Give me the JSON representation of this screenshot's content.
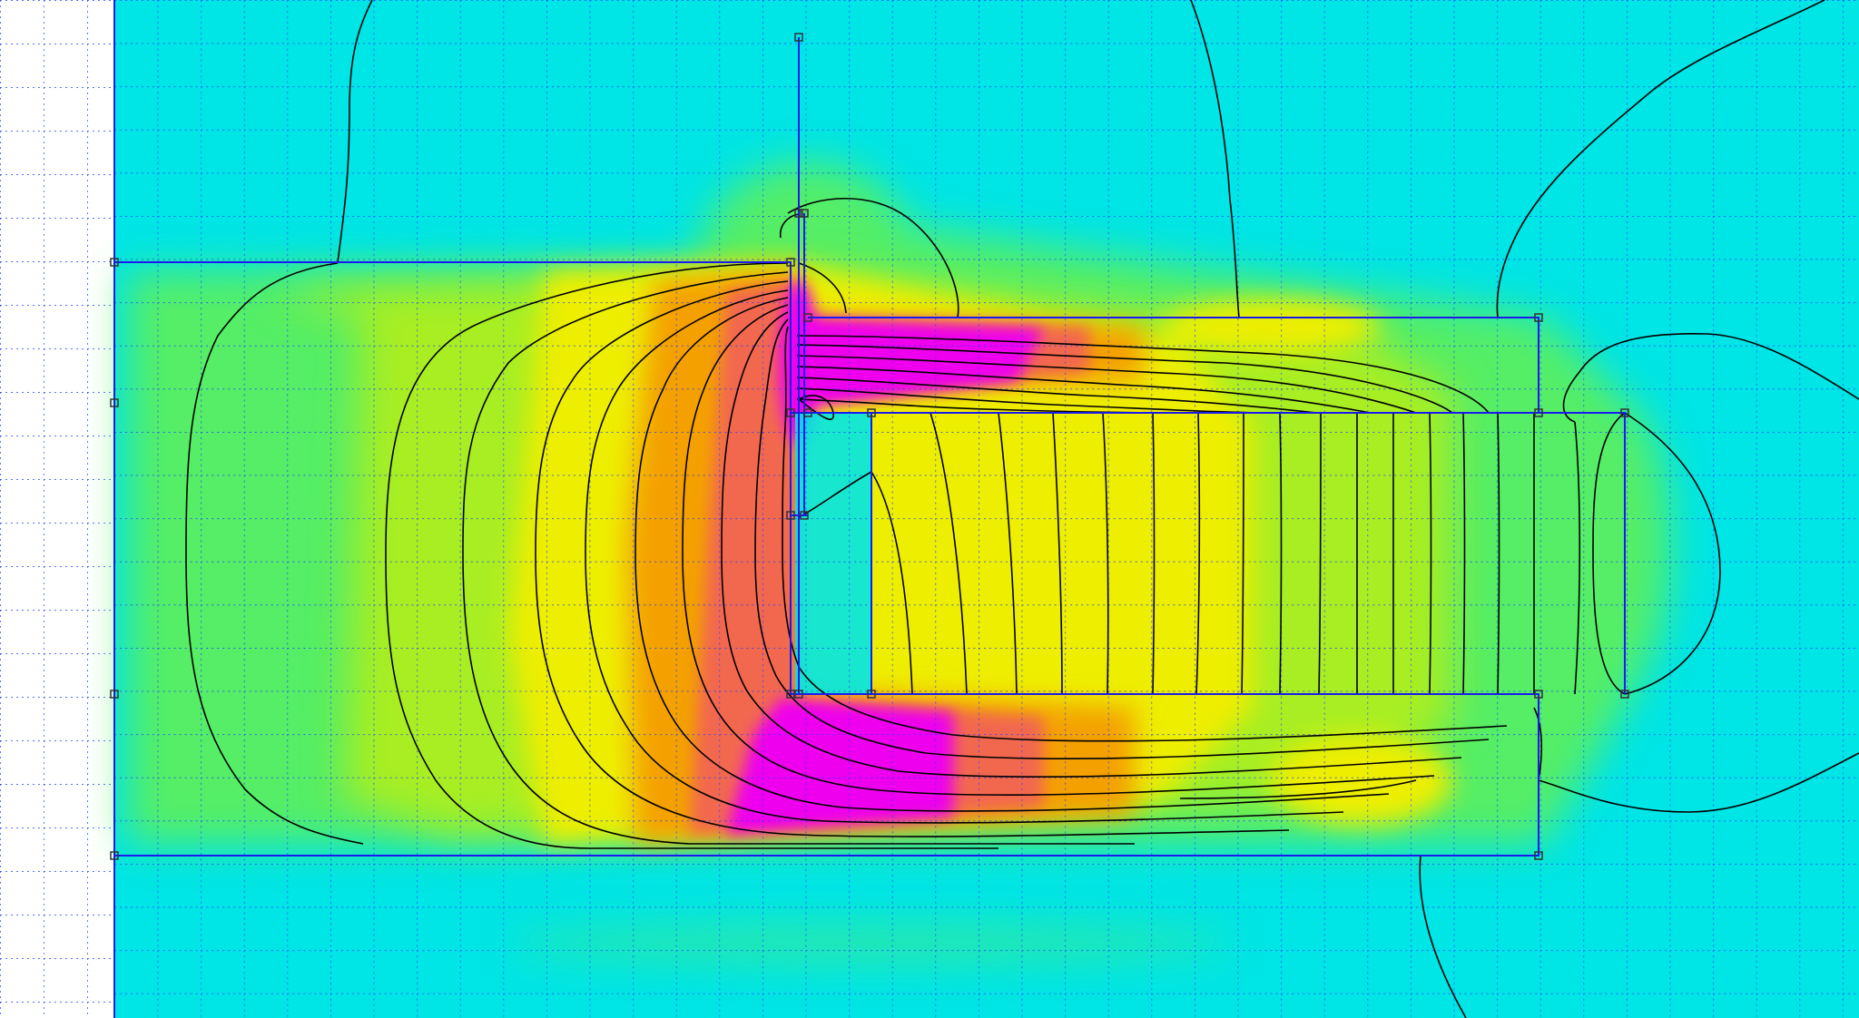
{
  "view": {
    "name": "fea-field-plot",
    "colors": {
      "air": "#00e5e5",
      "low": "#55ee66",
      "mid_low": "#a8ee22",
      "mid": "#eeee00",
      "mid_high": "#f4a000",
      "high": "#f26850",
      "max": "#ee00ee",
      "grid_dots": "#1e3cff",
      "boundary": "#1a1aee",
      "contour": "#000000",
      "node": "#333333"
    }
  }
}
